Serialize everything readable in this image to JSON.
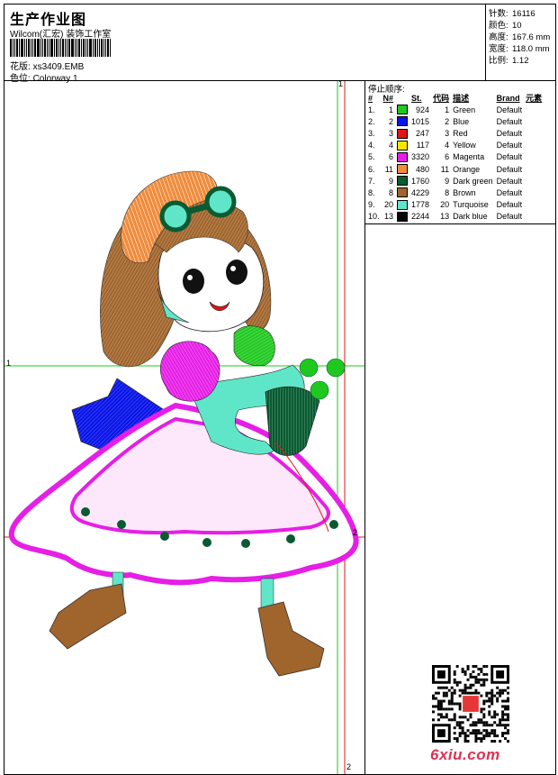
{
  "header": {
    "title": "生产作业图",
    "company": "Wilcom(汇宏) 装饰工作室",
    "design_label": "花版:",
    "design_value": "xs3409.EMB",
    "colorway_label": "色位:",
    "colorway_value": "Colorway 1"
  },
  "stats": [
    {
      "label": "针数:",
      "value": "16116"
    },
    {
      "label": "颜色:",
      "value": "10"
    },
    {
      "label": "高度:",
      "value": "167.6 mm"
    },
    {
      "label": "宽度:",
      "value": "118.0 mm"
    },
    {
      "label": "比例:",
      "value": "1.12"
    }
  ],
  "stop_sequence": {
    "title": "停止顺序:",
    "headers": [
      "#",
      "N#",
      "St.",
      "代码",
      "描述",
      "Brand",
      "元素"
    ],
    "rows": [
      {
        "idx": "1.",
        "n": "1",
        "color": "#1fc81f",
        "st": "924",
        "code": "1",
        "desc": "Green",
        "brand": "Default"
      },
      {
        "idx": "2.",
        "n": "2",
        "color": "#0a14e6",
        "st": "1015",
        "code": "2",
        "desc": "Blue",
        "brand": "Default"
      },
      {
        "idx": "3.",
        "n": "3",
        "color": "#e01414",
        "st": "247",
        "code": "3",
        "desc": "Red",
        "brand": "Default"
      },
      {
        "idx": "4.",
        "n": "4",
        "color": "#f5e600",
        "st": "117",
        "code": "4",
        "desc": "Yellow",
        "brand": "Default"
      },
      {
        "idx": "5.",
        "n": "6",
        "color": "#e61ee6",
        "st": "3320",
        "code": "6",
        "desc": "Magenta",
        "brand": "Default"
      },
      {
        "idx": "6.",
        "n": "11",
        "color": "#f08c3c",
        "st": "480",
        "code": "11",
        "desc": "Orange",
        "brand": "Default"
      },
      {
        "idx": "7.",
        "n": "9",
        "color": "#0a5a32",
        "st": "1760",
        "code": "9",
        "desc": "Dark green",
        "brand": "Default"
      },
      {
        "idx": "8.",
        "n": "8",
        "color": "#a0642d",
        "st": "4229",
        "code": "8",
        "desc": "Brown",
        "brand": "Default"
      },
      {
        "idx": "9.",
        "n": "20",
        "color": "#5fe6c8",
        "st": "1778",
        "code": "20",
        "desc": "Turquoise",
        "brand": "Default"
      },
      {
        "idx": "10.",
        "n": "13",
        "color": "#050505",
        "st": "2244",
        "code": "13",
        "desc": "Dark blue",
        "brand": "Default"
      }
    ]
  },
  "guides": {
    "top_label": "1",
    "left_label": "1",
    "right_label": "2",
    "bottom_label": "2"
  },
  "watermark": {
    "text": "6xiu.com"
  },
  "icons": {
    "barcode": "barcode-icon",
    "qr": "qr-code-icon"
  }
}
